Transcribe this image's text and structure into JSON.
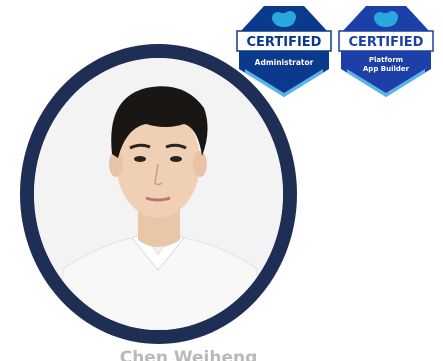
{
  "badges": [
    {
      "title": "CERTIFIED",
      "lines": [
        "Administrator"
      ],
      "color": "#0b3a8c",
      "icon": "salesforce-cloud-icon"
    },
    {
      "title": "CERTIFIED",
      "lines": [
        "Platform",
        "App Builder"
      ],
      "color": "#1c3fa8",
      "icon": "salesforce-cloud-icon"
    }
  ],
  "profile": {
    "name": "Chen Weiheng",
    "ring_color": "#1f2e55"
  }
}
